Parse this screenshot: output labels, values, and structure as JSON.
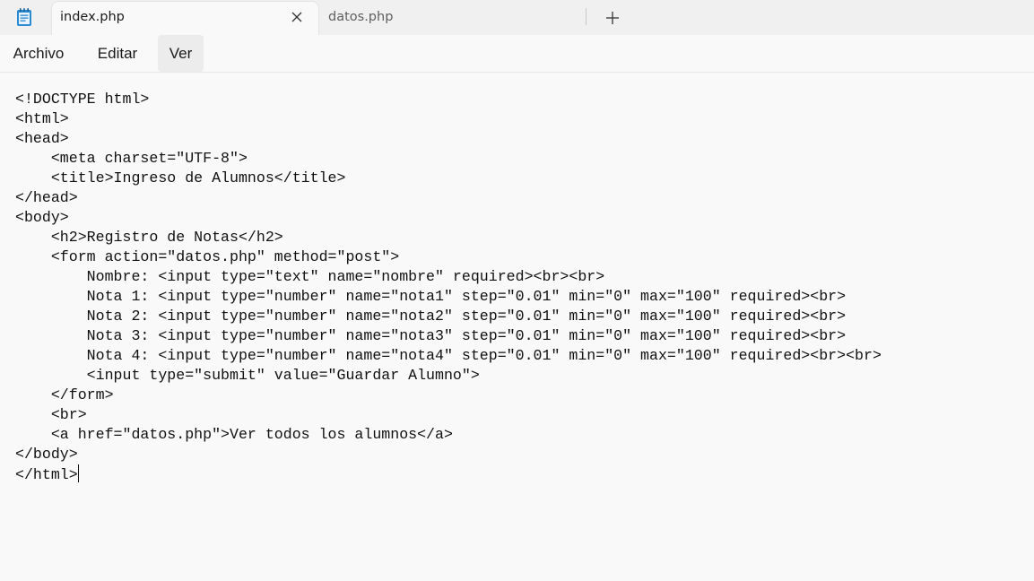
{
  "tabs": [
    {
      "label": "index.php",
      "active": true
    },
    {
      "label": "datos.php",
      "active": false
    }
  ],
  "menu": {
    "items": [
      "Archivo",
      "Editar",
      "Ver"
    ]
  },
  "icons": {
    "app": "notepad-icon",
    "close": "close-icon",
    "new_tab": "plus-icon"
  },
  "editor": {
    "lines": [
      "<!DOCTYPE html>",
      "<html>",
      "<head>",
      "    <meta charset=\"UTF-8\">",
      "    <title>Ingreso de Alumnos</title>",
      "</head>",
      "<body>",
      "    <h2>Registro de Notas</h2>",
      "    <form action=\"datos.php\" method=\"post\">",
      "        Nombre: <input type=\"text\" name=\"nombre\" required><br><br>",
      "        Nota 1: <input type=\"number\" name=\"nota1\" step=\"0.01\" min=\"0\" max=\"100\" required><br>",
      "        Nota 2: <input type=\"number\" name=\"nota2\" step=\"0.01\" min=\"0\" max=\"100\" required><br>",
      "        Nota 3: <input type=\"number\" name=\"nota3\" step=\"0.01\" min=\"0\" max=\"100\" required><br>",
      "        Nota 4: <input type=\"number\" name=\"nota4\" step=\"0.01\" min=\"0\" max=\"100\" required><br><br>",
      "        <input type=\"submit\" value=\"Guardar Alumno\">",
      "    </form>",
      "    <br>",
      "    <a href=\"datos.php\">Ver todos los alumnos</a>",
      "</body>",
      "</html>"
    ]
  },
  "colors": {
    "titlebar_bg": "#f0f0f0",
    "editor_bg": "#f9f9f9",
    "app_icon_blue": "#2a8ad4"
  }
}
